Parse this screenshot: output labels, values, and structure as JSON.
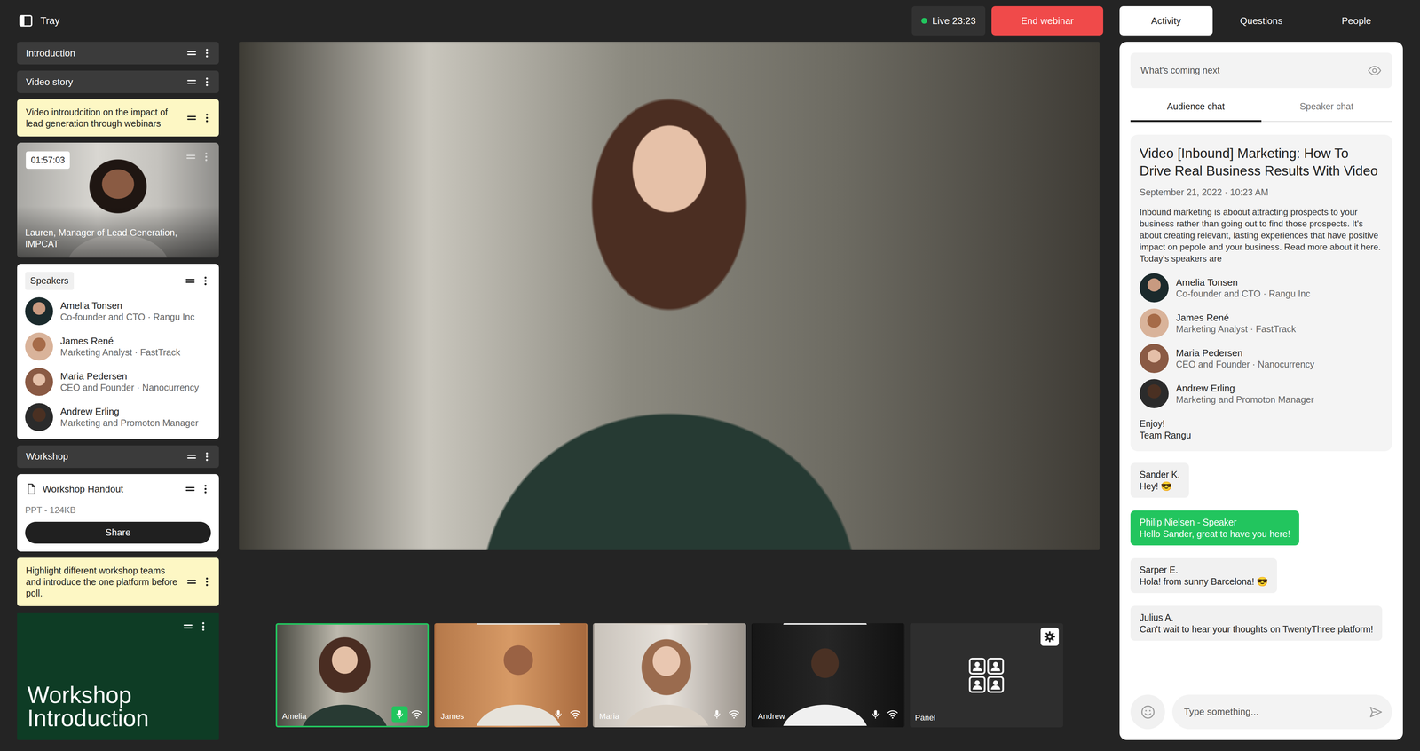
{
  "tray_header": {
    "title": "Tray"
  },
  "live": {
    "label": "Live 23:23",
    "on": true
  },
  "end_button": {
    "label": "End webinar"
  },
  "panel_tabs": [
    {
      "label": "Activity",
      "selected": true
    },
    {
      "label": "Questions",
      "selected": false
    },
    {
      "label": "People",
      "selected": false
    }
  ],
  "tray": [
    {
      "kind": "section",
      "label": "Introduction"
    },
    {
      "kind": "section",
      "label": "Video story"
    },
    {
      "kind": "note",
      "text": "Video introudcition on the impact of lead generation through webinars"
    },
    {
      "kind": "video",
      "time": "01:57:03",
      "caption": "Lauren, Manager of Lead Generation, IMPCAT"
    },
    {
      "kind": "speakers",
      "label": "Speakers",
      "speakers": [
        {
          "name": "Amelia Tonsen",
          "role": "Co-founder and CTO · Rangu Inc"
        },
        {
          "name": "James René",
          "role": "Marketing Analyst · FastTrack"
        },
        {
          "name": "Maria Pedersen",
          "role": "CEO and Founder · Nanocurrency"
        },
        {
          "name": "Andrew Erling",
          "role": "Marketing and Promoton Manager"
        }
      ]
    },
    {
      "kind": "section",
      "label": "Workshop"
    },
    {
      "kind": "file",
      "name": "Workshop Handout",
      "meta": "PPT - 124KB",
      "button": "Share"
    },
    {
      "kind": "note",
      "text": "Highlight different workshop teams and introduce the one platform before poll."
    },
    {
      "kind": "slide",
      "text": "Workshop Introduction"
    }
  ],
  "stage": {
    "participants": [
      {
        "name": "Amelia",
        "selected": true,
        "speaking": true
      },
      {
        "name": "James",
        "selected": false,
        "speaking": false
      },
      {
        "name": "Maria",
        "selected": false,
        "speaking": false
      },
      {
        "name": "Andrew",
        "selected": false,
        "speaking": false
      }
    ],
    "panel_tile": {
      "label": "Panel"
    }
  },
  "activity": {
    "coming_next": "What's coming next",
    "chat_tabs": [
      {
        "label": "Audience chat",
        "selected": true
      },
      {
        "label": "Speaker chat",
        "selected": false
      }
    ],
    "post": {
      "title": "Video [Inbound] Marketing: How To Drive Real Business Results With Video",
      "date": "September 21, 2022 · 10:23 AM",
      "body": "Inbound marketing is aboout attracting prospects to your business rather than going out to find those prospects. It's about creating relevant, lasting experiences that have positive impact on pepole and your business. Read more about it here. Today's speakers are",
      "speakers": [
        {
          "name": "Amelia Tonsen",
          "role": "Co-founder and CTO · Rangu Inc"
        },
        {
          "name": "James René",
          "role": "Marketing Analyst · FastTrack"
        },
        {
          "name": "Maria Pedersen",
          "role": "CEO and Founder · Nanocurrency"
        },
        {
          "name": "Andrew Erling",
          "role": "Marketing and Promoton Manager"
        }
      ],
      "closing": [
        "Enjoy!",
        "Team Rangu"
      ]
    },
    "messages": [
      {
        "author": "Sander K.",
        "text": "Hey! 😎",
        "speaker": false
      },
      {
        "author": "Philip Nielsen - Speaker",
        "text": "Hello Sander, great to have you here!",
        "speaker": true
      },
      {
        "author": "Sarper E.",
        "text": "Hola! from sunny Barcelona! 😎",
        "speaker": false
      },
      {
        "author": "Julius A.",
        "text": "Can't wait to hear your thoughts on TwentyThree platform!",
        "speaker": false
      }
    ],
    "input": {
      "placeholder": "Type something..."
    }
  }
}
